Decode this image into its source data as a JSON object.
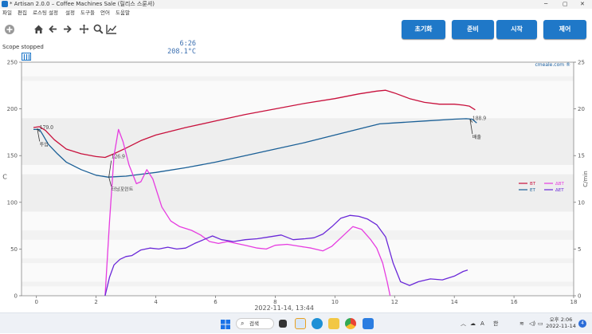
{
  "window": {
    "title": "* Artisan 2.0.0 – Coffee Machines Sale (릴리스 스룬셔)",
    "controls": [
      "─",
      "▢",
      "✕"
    ]
  },
  "menu": [
    "파일",
    "편집",
    "로스팅 설정",
    "설정",
    "도구들",
    "언어",
    "도움말"
  ],
  "toolbar": {
    "icons": [
      "plus-circle-icon",
      "home-icon",
      "back-arrow-icon",
      "forward-arrow-icon",
      "move-icon",
      "zoom-icon",
      "chart-icon"
    ],
    "lcd_time": "6:26",
    "lcd_temp": "208.1°C",
    "buttons": {
      "reset": "초기화",
      "ready": "준비",
      "start": "시작",
      "control": "제어"
    }
  },
  "status": {
    "scope": "Scope stopped",
    "watermark": "cmeale.com ®"
  },
  "chart_data": {
    "type": "line",
    "title": "",
    "xlabel": "2022-11-14, 13:44",
    "ylabel": "C",
    "ylabel_right": "C/min",
    "xlim": [
      -0.5,
      18
    ],
    "ylim": [
      0,
      250
    ],
    "ylim_right": [
      0,
      25
    ],
    "xticks": [
      0,
      2,
      4,
      6,
      8,
      10,
      12,
      14,
      16,
      18
    ],
    "yticks": [
      0,
      50,
      100,
      150,
      200,
      250
    ],
    "yticks_right": [
      0,
      5,
      10,
      15,
      20,
      25
    ],
    "legend": [
      "BT",
      "ET",
      "ΔBT",
      "ΔET"
    ],
    "legend_position": "center-right",
    "colors": {
      "BT": "#c8103c",
      "ET": "#1a5f96",
      "dBT": "#e63ce0",
      "dET": "#6a28d8"
    },
    "annotations": [
      {
        "label": "179.0",
        "x": 0.0,
        "y": 179
      },
      {
        "label": "투입",
        "x": 0.0,
        "y": 160
      },
      {
        "label": "126.9",
        "x": 2.4,
        "y": 148
      },
      {
        "label": "터닝포인트",
        "x": 2.4,
        "y": 112
      },
      {
        "label": "188.9",
        "x": 14.5,
        "y": 188.9
      },
      {
        "label": "배출",
        "x": 14.5,
        "y": 168
      }
    ],
    "series": [
      {
        "name": "BT",
        "axis": "left",
        "points": [
          [
            -0.1,
            180
          ],
          [
            0.1,
            181
          ],
          [
            0.3,
            177
          ],
          [
            0.6,
            167
          ],
          [
            1.0,
            157
          ],
          [
            1.5,
            152
          ],
          [
            2.0,
            149
          ],
          [
            2.3,
            148
          ],
          [
            2.6,
            152
          ],
          [
            3.0,
            158
          ],
          [
            3.5,
            166
          ],
          [
            4.0,
            172
          ],
          [
            5.0,
            180
          ],
          [
            6.0,
            187
          ],
          [
            7.0,
            194
          ],
          [
            8.0,
            200
          ],
          [
            9.0,
            206
          ],
          [
            10.0,
            211
          ],
          [
            10.8,
            216
          ],
          [
            11.4,
            219
          ],
          [
            11.7,
            220
          ],
          [
            12.0,
            217
          ],
          [
            12.5,
            211
          ],
          [
            13.0,
            207
          ],
          [
            13.5,
            205
          ],
          [
            14.0,
            205
          ],
          [
            14.3,
            204
          ],
          [
            14.5,
            203
          ],
          [
            14.7,
            199
          ]
        ]
      },
      {
        "name": "ET",
        "axis": "left",
        "points": [
          [
            -0.1,
            178
          ],
          [
            0.1,
            178
          ],
          [
            0.2,
            173
          ],
          [
            0.4,
            162
          ],
          [
            0.7,
            152
          ],
          [
            1.0,
            143
          ],
          [
            1.5,
            135
          ],
          [
            2.0,
            129
          ],
          [
            2.4,
            127
          ],
          [
            3.0,
            128
          ],
          [
            3.5,
            130
          ],
          [
            4.0,
            132
          ],
          [
            5.0,
            137
          ],
          [
            6.0,
            143
          ],
          [
            7.0,
            150
          ],
          [
            8.0,
            157
          ],
          [
            9.0,
            164
          ],
          [
            10.0,
            172
          ],
          [
            11.0,
            180
          ],
          [
            11.5,
            184
          ],
          [
            12.0,
            185
          ],
          [
            13.0,
            187
          ],
          [
            14.0,
            189
          ],
          [
            14.4,
            189.5
          ],
          [
            14.6,
            189
          ],
          [
            14.75,
            185
          ]
        ]
      },
      {
        "name": "ΔBT",
        "axis": "right",
        "points": [
          [
            2.3,
            0
          ],
          [
            2.45,
            8
          ],
          [
            2.6,
            15
          ],
          [
            2.75,
            17.8
          ],
          [
            2.9,
            16.5
          ],
          [
            3.1,
            14
          ],
          [
            3.35,
            12
          ],
          [
            3.5,
            12.2
          ],
          [
            3.7,
            13.5
          ],
          [
            3.9,
            12.5
          ],
          [
            4.2,
            9.5
          ],
          [
            4.5,
            8
          ],
          [
            4.8,
            7.4
          ],
          [
            5.2,
            7
          ],
          [
            5.5,
            6.5
          ],
          [
            5.8,
            5.8
          ],
          [
            6.1,
            5.6
          ],
          [
            6.4,
            5.8
          ],
          [
            6.7,
            5.6
          ],
          [
            7.0,
            5.4
          ],
          [
            7.4,
            5.1
          ],
          [
            7.7,
            5.0
          ],
          [
            8.0,
            5.4
          ],
          [
            8.4,
            5.5
          ],
          [
            8.8,
            5.3
          ],
          [
            9.2,
            5.1
          ],
          [
            9.6,
            4.8
          ],
          [
            9.9,
            5.3
          ],
          [
            10.3,
            6.5
          ],
          [
            10.6,
            7.4
          ],
          [
            10.9,
            7.1
          ],
          [
            11.2,
            6.0
          ],
          [
            11.4,
            5.1
          ],
          [
            11.6,
            3.5
          ],
          [
            11.75,
            1.5
          ],
          [
            11.85,
            0
          ]
        ]
      },
      {
        "name": "ΔET",
        "axis": "right",
        "points": [
          [
            2.3,
            0
          ],
          [
            2.45,
            2
          ],
          [
            2.6,
            3.3
          ],
          [
            2.8,
            3.9
          ],
          [
            3.0,
            4.2
          ],
          [
            3.2,
            4.3
          ],
          [
            3.5,
            4.9
          ],
          [
            3.8,
            5.1
          ],
          [
            4.1,
            5.0
          ],
          [
            4.4,
            5.2
          ],
          [
            4.7,
            5.0
          ],
          [
            5.0,
            5.1
          ],
          [
            5.3,
            5.6
          ],
          [
            5.6,
            6.0
          ],
          [
            5.9,
            6.4
          ],
          [
            6.2,
            6.0
          ],
          [
            6.6,
            5.8
          ],
          [
            7.0,
            6.0
          ],
          [
            7.4,
            6.1
          ],
          [
            7.8,
            6.3
          ],
          [
            8.2,
            6.5
          ],
          [
            8.6,
            6.0
          ],
          [
            9.0,
            6.1
          ],
          [
            9.3,
            6.2
          ],
          [
            9.6,
            6.6
          ],
          [
            9.9,
            7.4
          ],
          [
            10.2,
            8.3
          ],
          [
            10.5,
            8.6
          ],
          [
            10.8,
            8.5
          ],
          [
            11.1,
            8.2
          ],
          [
            11.4,
            7.6
          ],
          [
            11.7,
            6.3
          ],
          [
            11.95,
            3.5
          ],
          [
            12.2,
            1.5
          ],
          [
            12.5,
            1.1
          ],
          [
            12.8,
            1.5
          ],
          [
            13.2,
            1.8
          ],
          [
            13.6,
            1.7
          ],
          [
            14.0,
            2.1
          ],
          [
            14.3,
            2.6
          ],
          [
            14.45,
            2.75
          ]
        ]
      }
    ]
  }
}
